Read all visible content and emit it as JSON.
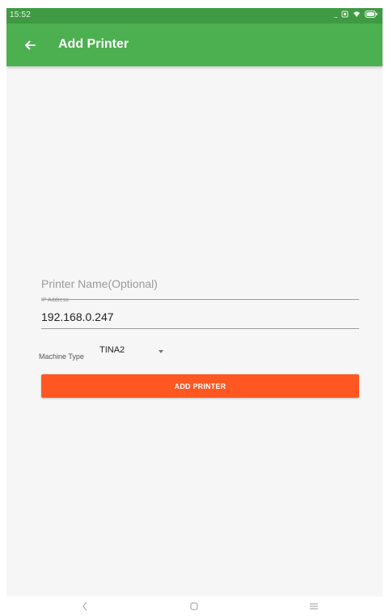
{
  "status_bar": {
    "time": "15:52",
    "more_indicator": "...",
    "icons": [
      "sim-icon",
      "wifi-icon",
      "battery-icon"
    ]
  },
  "app_bar": {
    "title": "Add Printer",
    "back_icon": "arrow-left-icon",
    "color": "#4caf50"
  },
  "form": {
    "printer_name": {
      "placeholder": "Printer Name(Optional)",
      "value": ""
    },
    "ip_address": {
      "label": "IP Address",
      "value": "192.168.0.247"
    },
    "machine_type": {
      "label": "Machine Type",
      "selected": "TINA2"
    },
    "submit_label": "ADD PRINTER",
    "submit_color": "#ff5722"
  },
  "nav_bar": {
    "icons": [
      "back-icon",
      "home-icon",
      "menu-icon"
    ]
  }
}
